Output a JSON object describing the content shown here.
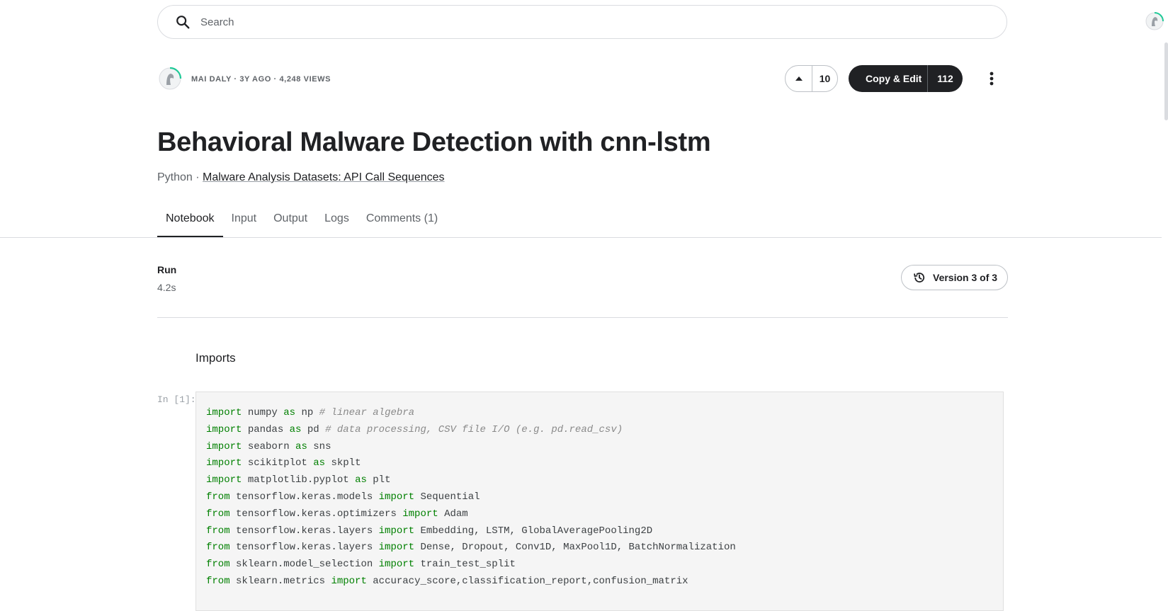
{
  "search": {
    "placeholder": "Search"
  },
  "author": {
    "meta": "MAI DALY · 3Y AGO · 4,248 VIEWS"
  },
  "actions": {
    "vote_count": "10",
    "copy_edit_label": "Copy & Edit",
    "copy_edit_count": "112"
  },
  "notebook": {
    "title": "Behavioral Malware Detection with cnn-lstm",
    "language": "Python ·",
    "dataset_link": "Malware Analysis Datasets: API Call Sequences"
  },
  "tabs": [
    {
      "label": "Notebook",
      "active": true
    },
    {
      "label": "Input",
      "active": false
    },
    {
      "label": "Output",
      "active": false
    },
    {
      "label": "Logs",
      "active": false
    },
    {
      "label": "Comments (1)",
      "active": false
    }
  ],
  "run": {
    "label": "Run",
    "time": "4.2s",
    "version": "Version 3 of 3"
  },
  "cells": {
    "markdown_heading": "Imports",
    "prompt": "In [1]:",
    "code_lines": [
      [
        [
          "kw",
          "import"
        ],
        [
          "t",
          " numpy "
        ],
        [
          "kw",
          "as"
        ],
        [
          "t",
          " np "
        ],
        [
          "cm",
          "# linear algebra"
        ]
      ],
      [
        [
          "kw",
          "import"
        ],
        [
          "t",
          " pandas "
        ],
        [
          "kw",
          "as"
        ],
        [
          "t",
          " pd "
        ],
        [
          "cm",
          "# data processing, CSV file I/O (e.g. pd.read_csv)"
        ]
      ],
      [
        [
          "kw",
          "import"
        ],
        [
          "t",
          " seaborn "
        ],
        [
          "kw",
          "as"
        ],
        [
          "t",
          " sns"
        ]
      ],
      [
        [
          "kw",
          "import"
        ],
        [
          "t",
          " scikitplot "
        ],
        [
          "kw",
          "as"
        ],
        [
          "t",
          " skplt"
        ]
      ],
      [
        [
          "kw",
          "import"
        ],
        [
          "t",
          " matplotlib.pyplot "
        ],
        [
          "kw",
          "as"
        ],
        [
          "t",
          " plt"
        ]
      ],
      [
        [
          "kw",
          "from"
        ],
        [
          "t",
          " tensorflow.keras.models "
        ],
        [
          "kw",
          "import"
        ],
        [
          "t",
          " Sequential"
        ]
      ],
      [
        [
          "kw",
          "from"
        ],
        [
          "t",
          " tensorflow.keras.optimizers "
        ],
        [
          "kw",
          "import"
        ],
        [
          "t",
          " Adam"
        ]
      ],
      [
        [
          "kw",
          "from"
        ],
        [
          "t",
          " tensorflow.keras.layers "
        ],
        [
          "kw",
          "import"
        ],
        [
          "t",
          " Embedding, LSTM, GlobalAveragePooling2D"
        ]
      ],
      [
        [
          "kw",
          "from"
        ],
        [
          "t",
          " tensorflow.keras.layers "
        ],
        [
          "kw",
          "import"
        ],
        [
          "t",
          " Dense, Dropout, Conv1D, MaxPool1D, BatchNormalization"
        ]
      ],
      [
        [
          "kw",
          "from"
        ],
        [
          "t",
          " sklearn.model_selection "
        ],
        [
          "kw",
          "import"
        ],
        [
          "t",
          " train_test_split"
        ]
      ],
      [
        [
          "kw",
          "from"
        ],
        [
          "t",
          " sklearn.metrics "
        ],
        [
          "kw",
          "import"
        ],
        [
          "t",
          " accuracy_score,classification_report,confusion_matrix"
        ]
      ]
    ]
  },
  "icons": {
    "search": "search-icon",
    "avatar": "avatar-icon",
    "upvote": "upvote-arrow-icon",
    "more": "more-vertical-icon",
    "history": "history-icon"
  },
  "colors": {
    "primary_dark": "#202124",
    "keyword_green": "#008000",
    "comment_gray": "#8a8a8a",
    "avatar_ring": "#20beff"
  }
}
